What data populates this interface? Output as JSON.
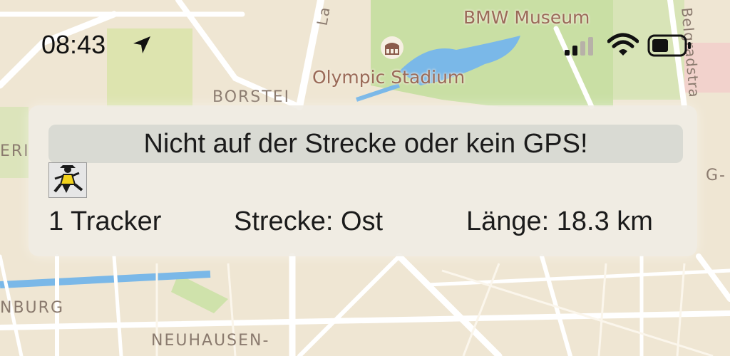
{
  "status_bar": {
    "time": "08:43",
    "icons": [
      "location-arrow-icon",
      "cellular-signal-icon",
      "wifi-icon",
      "battery-icon"
    ]
  },
  "map": {
    "district_labels": [
      "BORSTEI",
      "NEUHAUSEN-",
      "NBURG",
      "ERI",
      "G-"
    ],
    "street_labels": [
      "Belgradstra",
      "La"
    ],
    "poi_labels": [
      "BMW Museum",
      "Olympic Stadium"
    ],
    "poi_icons": [
      "stadium-icon"
    ]
  },
  "panel": {
    "banner": "Nicht auf der Strecke oder kein GPS!",
    "tracker_avatar_icon": "tracker-avatar-icon",
    "tracker_count": "1 Tracker",
    "route": "Strecke: Ost",
    "length": "Länge: 18.3 km"
  },
  "colors": {
    "map_land": "#efe6d3",
    "park": "#c9dfa4",
    "water": "#7ab8e8",
    "road": "#ffffff",
    "panel_bg": "#efece4"
  }
}
